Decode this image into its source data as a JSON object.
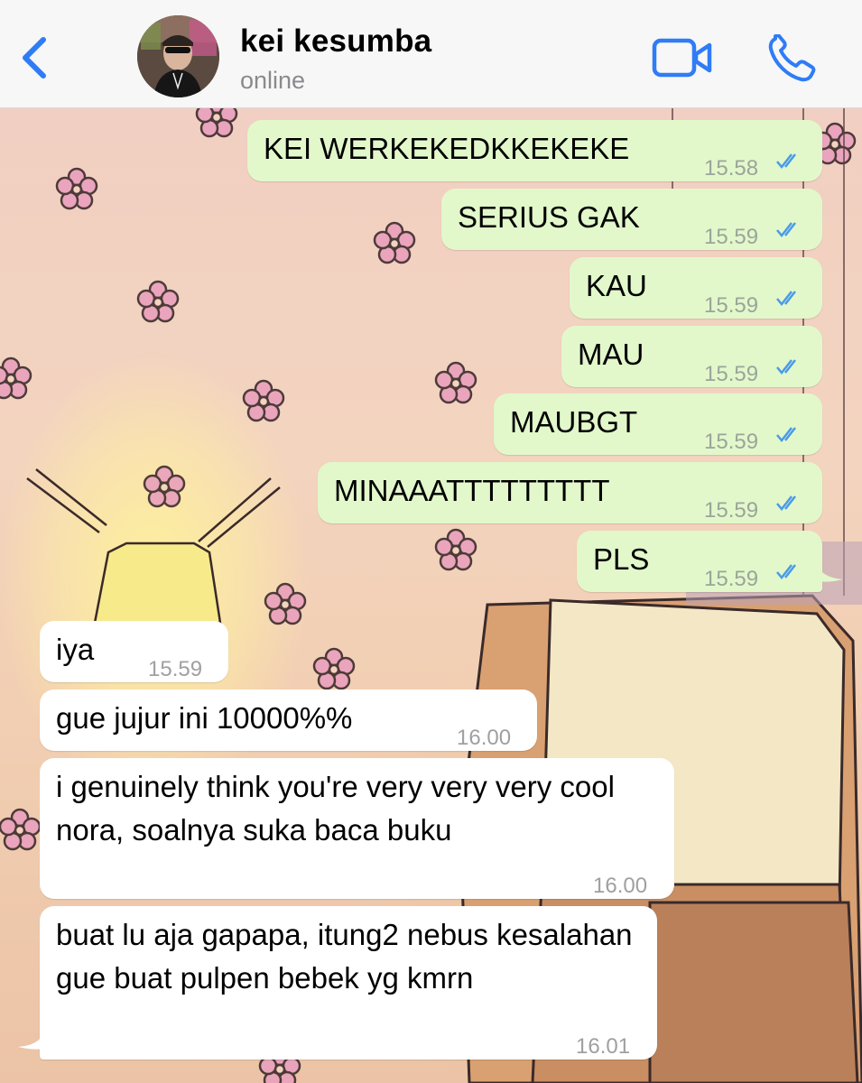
{
  "header": {
    "back_icon": "chevron-left-icon",
    "contact_name": "kei kesumba",
    "status": "online",
    "video_icon": "video-camera-icon",
    "call_icon": "phone-icon",
    "accent_color": "#2f7cf6"
  },
  "messages": [
    {
      "direction": "outgoing",
      "text": "KEI WERKEKEDKKEKEKE",
      "time": "15.58",
      "status": "read"
    },
    {
      "direction": "outgoing",
      "text": "SERIUS GAK",
      "time": "15.59",
      "status": "read"
    },
    {
      "direction": "outgoing",
      "text": "KAU",
      "time": "15.59",
      "status": "read"
    },
    {
      "direction": "outgoing",
      "text": "MAU",
      "time": "15.59",
      "status": "read"
    },
    {
      "direction": "outgoing",
      "text": "MAUBGT",
      "time": "15.59",
      "status": "read"
    },
    {
      "direction": "outgoing",
      "text": "MINAAATTTTTTTTT",
      "time": "15.59",
      "status": "read"
    },
    {
      "direction": "outgoing",
      "text": "PLS",
      "time": "15.59",
      "status": "read"
    },
    {
      "direction": "incoming",
      "text": "iya",
      "time": "15.59"
    },
    {
      "direction": "incoming",
      "text": "gue jujur ini 10000%%",
      "time": "16.00"
    },
    {
      "direction": "incoming",
      "text": "i genuinely think you're very very very cool nora, soalnya suka baca buku",
      "time": "16.00"
    },
    {
      "direction": "incoming",
      "text": "buat lu aja gapapa, itung2 nebus kesalahan gue buat pulpen bebek yg kmrn",
      "time": "16.01"
    }
  ],
  "colors": {
    "outgoing_bubble": "#e2f8cb",
    "incoming_bubble": "#ffffff",
    "read_ticks": "#4a9ae8"
  }
}
